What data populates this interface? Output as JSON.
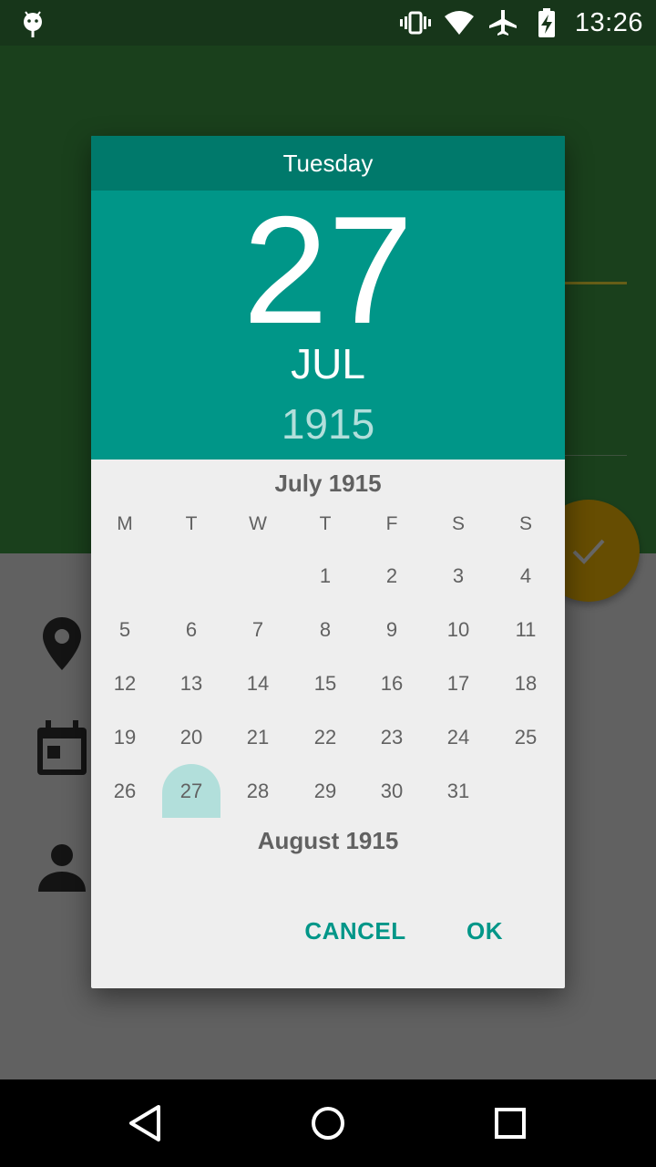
{
  "status_bar": {
    "time": "13:26",
    "icons": [
      "android-debug-icon",
      "vibrate-icon",
      "wifi-icon",
      "airplane-mode-icon",
      "battery-charging-icon"
    ]
  },
  "background_app": {
    "icons": [
      "location-pin-icon",
      "calendar-icon",
      "person-icon",
      "check-icon"
    ],
    "colors": {
      "header": "#43a047",
      "fab": "#ffc107",
      "accent_underline": "#ffeb3b"
    }
  },
  "dialog": {
    "header": {
      "day_of_week": "Tuesday",
      "day": "27",
      "month": "JUL",
      "year": "1915"
    },
    "calendar": {
      "title": "July 1915",
      "weekdays": [
        "M",
        "T",
        "W",
        "T",
        "F",
        "S",
        "S"
      ],
      "weeks": [
        [
          "",
          "",
          "",
          "1",
          "2",
          "3",
          "4"
        ],
        [
          "5",
          "6",
          "7",
          "8",
          "9",
          "10",
          "11"
        ],
        [
          "12",
          "13",
          "14",
          "15",
          "16",
          "17",
          "18"
        ],
        [
          "19",
          "20",
          "21",
          "22",
          "23",
          "24",
          "25"
        ],
        [
          "26",
          "27",
          "28",
          "29",
          "30",
          "31",
          ""
        ]
      ],
      "selected_day": "27",
      "next_month_title": "August 1915"
    },
    "buttons": {
      "cancel": "CANCEL",
      "ok": "OK"
    },
    "colors": {
      "header": "#009688",
      "header_dark": "#00796b",
      "selected": "#b2dfdb",
      "accent": "#009688"
    }
  },
  "nav_bar": {
    "icons": [
      "back-icon",
      "home-icon",
      "recents-icon"
    ]
  }
}
